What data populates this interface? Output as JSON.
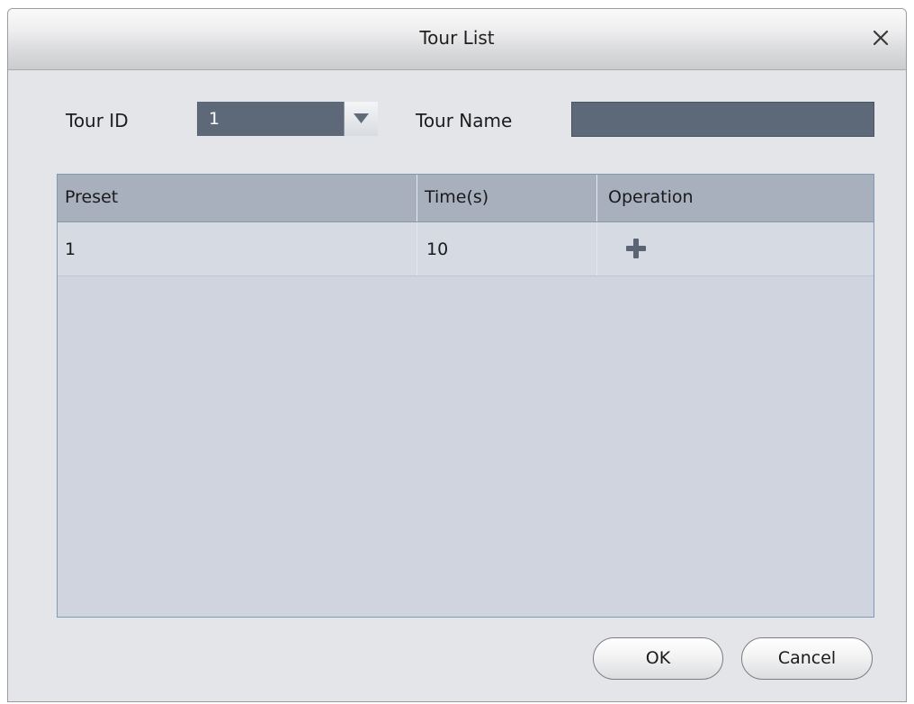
{
  "dialog": {
    "title": "Tour List",
    "close_icon": "close-icon"
  },
  "form": {
    "tour_id_label": "Tour ID",
    "tour_id_value": "1",
    "dropdown_icon": "triangle-down-icon",
    "tour_name_label": "Tour Name",
    "tour_name_value": ""
  },
  "table": {
    "headers": [
      "Preset",
      "Time(s)",
      "Operation"
    ],
    "rows": [
      {
        "preset": "1",
        "time": "10",
        "operation_icon": "plus-icon"
      }
    ]
  },
  "buttons": {
    "ok_label": "OK",
    "cancel_label": "Cancel"
  },
  "colors": {
    "field_bg": "#5d6879",
    "header_bg": "#a8b0be",
    "table_bg": "#cfd4de"
  }
}
